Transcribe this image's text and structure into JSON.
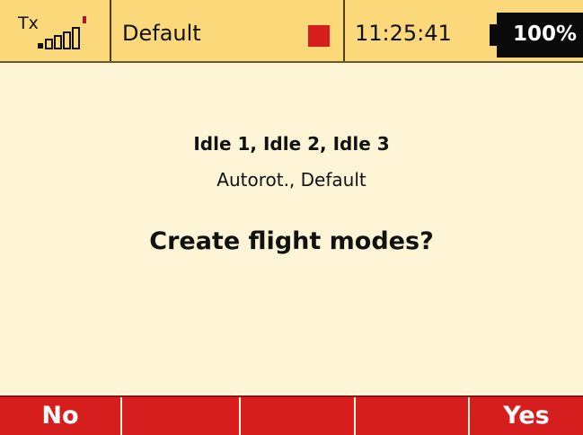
{
  "status_bar": {
    "tx_label": "Tx",
    "signal_icon": "signal-strength-icon",
    "model_name": "Default",
    "recording_indicator_color": "#d71e1e",
    "time": "11:25:41",
    "battery": "100%"
  },
  "dialog": {
    "line1": "Idle 1, Idle 2, Idle 3",
    "line2": "Autorot., Default",
    "question": "Create flight modes?"
  },
  "softkeys": {
    "f1": "No",
    "f2": "",
    "f3": "",
    "f4": "",
    "f5": "Yes"
  },
  "colors": {
    "status_bar_bg": "#fbd97a",
    "screen_bg": "#fdf5d5",
    "softkey_bg": "#d71e1e",
    "battery_bg": "#0a0a0a"
  }
}
